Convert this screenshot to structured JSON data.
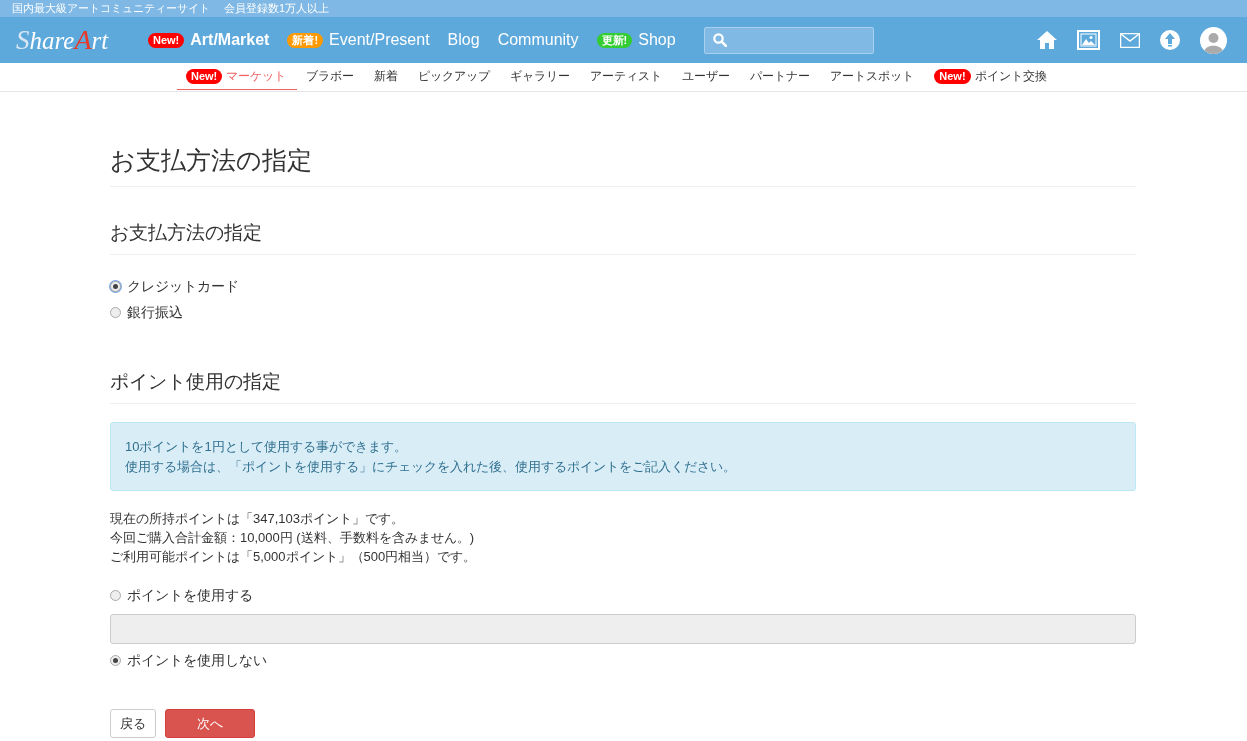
{
  "top_bar": {
    "tagline": "国内最大級アートコミュニティーサイト",
    "members": "会員登録数1万人以上"
  },
  "header": {
    "logo": [
      {
        "text": "S",
        "kind": "initial"
      },
      {
        "text": "hare",
        "kind": "plain"
      },
      {
        "text": "A",
        "kind": "accent"
      },
      {
        "text": "rt",
        "kind": "plain"
      }
    ],
    "nav": [
      {
        "label": "Art/Market",
        "bold": true,
        "badge": {
          "text": "New!",
          "color": "#ff0000"
        }
      },
      {
        "label": "Event/Present",
        "bold": false,
        "badge": {
          "text": "新着!",
          "color": "#ff9900"
        }
      },
      {
        "label": "Blog",
        "bold": false
      },
      {
        "label": "Community",
        "bold": false
      },
      {
        "label": "Shop",
        "bold": false,
        "badge": {
          "text": "更新!",
          "color": "#33cc33"
        }
      }
    ]
  },
  "subnav": [
    {
      "label": "マーケット",
      "selected": true,
      "badge": {
        "text": "New!",
        "color": "#ff0000"
      }
    },
    {
      "label": "ブラボー",
      "selected": false
    },
    {
      "label": "新着",
      "selected": false
    },
    {
      "label": "ピックアップ",
      "selected": false
    },
    {
      "label": "ギャラリー",
      "selected": false
    },
    {
      "label": "アーティスト",
      "selected": false
    },
    {
      "label": "ユーザー",
      "selected": false
    },
    {
      "label": "パートナー",
      "selected": false
    },
    {
      "label": "アートスポット",
      "selected": false
    },
    {
      "label": "ポイント交換",
      "selected": false,
      "badge": {
        "text": "New!",
        "color": "#ff0000"
      }
    }
  ],
  "page_title": "お支払方法の指定",
  "payment": {
    "heading": "お支払方法の指定",
    "options": [
      {
        "label": "クレジットカード",
        "selected": true
      },
      {
        "label": "銀行振込",
        "selected": false
      }
    ]
  },
  "points": {
    "heading": "ポイント使用の指定",
    "info": [
      "10ポイントを1円として使用する事ができます。",
      "使用する場合は、「ポイントを使用する」にチェックを入れた後、使用するポイントをご記入ください。"
    ],
    "summary": [
      "現在の所持ポイントは「347,103ポイント」です。",
      "今回ご購入合計金額：10,000円 (送料、手数料を含みません。)",
      "ご利用可能ポイントは「5,000ポイント」（500円相当）です。"
    ],
    "use": {
      "label": "ポイントを使用する",
      "selected": false
    },
    "amount_field": {
      "disabled": true
    },
    "no_use": {
      "label": "ポイントを使用しない",
      "selected": true
    }
  },
  "buttons": {
    "back": "戻る",
    "next": "次へ"
  }
}
